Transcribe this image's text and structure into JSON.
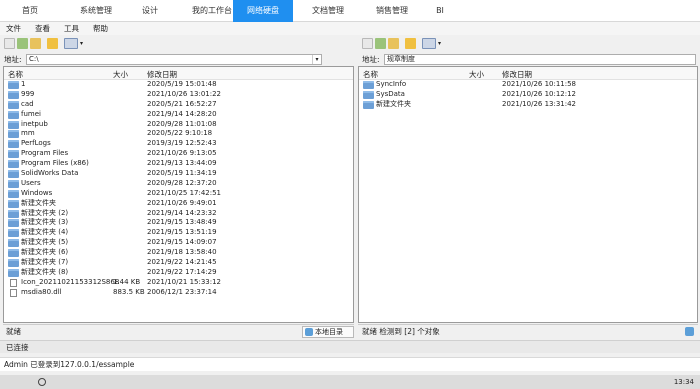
{
  "topnav": {
    "tabs": [
      "首页",
      "系统管理",
      "设计",
      "我的工作台",
      "网络硬盘",
      "文档管理",
      "销售管理",
      "BI"
    ],
    "active_index": 4
  },
  "menubar": [
    "文件",
    "查看",
    "工具",
    "帮助"
  ],
  "left": {
    "address_label": "地址:",
    "address_value": "C:\\",
    "columns": {
      "name": "名称",
      "size": "大小",
      "date": "修改日期"
    },
    "rows": [
      {
        "name": "1",
        "size": "",
        "date": "2020/5/19 15:01:48",
        "type": "folder"
      },
      {
        "name": "999",
        "size": "",
        "date": "2021/10/26 13:01:22",
        "type": "folder"
      },
      {
        "name": "cad",
        "size": "",
        "date": "2020/5/21 16:52:27",
        "type": "folder"
      },
      {
        "name": "fumei",
        "size": "",
        "date": "2021/9/14 14:28:20",
        "type": "folder"
      },
      {
        "name": "inetpub",
        "size": "",
        "date": "2020/9/28 11:01:08",
        "type": "folder"
      },
      {
        "name": "mm",
        "size": "",
        "date": "2020/5/22 9:10:18",
        "type": "folder"
      },
      {
        "name": "PerfLogs",
        "size": "",
        "date": "2019/3/19 12:52:43",
        "type": "folder"
      },
      {
        "name": "Program Files",
        "size": "",
        "date": "2021/10/26 9:13:05",
        "type": "folder"
      },
      {
        "name": "Program Files (x86)",
        "size": "",
        "date": "2021/9/13 13:44:09",
        "type": "folder"
      },
      {
        "name": "SolidWorks Data",
        "size": "",
        "date": "2020/5/19 11:34:19",
        "type": "folder"
      },
      {
        "name": "Users",
        "size": "",
        "date": "2020/9/28 12:37:20",
        "type": "folder"
      },
      {
        "name": "Windows",
        "size": "",
        "date": "2021/10/25 17:42:51",
        "type": "folder"
      },
      {
        "name": "新建文件夹",
        "size": "",
        "date": "2021/10/26 9:49:01",
        "type": "folder"
      },
      {
        "name": "新建文件夹 (2)",
        "size": "",
        "date": "2021/9/14 14:23:32",
        "type": "folder"
      },
      {
        "name": "新建文件夹 (3)",
        "size": "",
        "date": "2021/9/15 13:48:49",
        "type": "folder"
      },
      {
        "name": "新建文件夹 (4)",
        "size": "",
        "date": "2021/9/15 13:51:19",
        "type": "folder"
      },
      {
        "name": "新建文件夹 (5)",
        "size": "",
        "date": "2021/9/15 14:09:07",
        "type": "folder"
      },
      {
        "name": "新建文件夹 (6)",
        "size": "",
        "date": "2021/9/18 13:58:40",
        "type": "folder"
      },
      {
        "name": "新建文件夹 (7)",
        "size": "",
        "date": "2021/9/22 14:21:45",
        "type": "folder"
      },
      {
        "name": "新建文件夹 (8)",
        "size": "",
        "date": "2021/9/22 17:14:29",
        "type": "folder"
      },
      {
        "name": "Icon_20211021153312S868",
        "size": "1.44 KB",
        "date": "2021/10/21 15:33:12",
        "type": "file"
      },
      {
        "name": "msdia80.dll",
        "size": "883.5 KB",
        "date": "2006/12/1 23:37:14",
        "type": "file"
      }
    ],
    "status_text": "就绪",
    "status_button": "本地目录"
  },
  "right": {
    "address_label": "地址:",
    "address_value": "规章制度",
    "columns": {
      "name": "名称",
      "size": "大小",
      "date": "修改日期"
    },
    "rows": [
      {
        "name": "SyncInfo",
        "size": "",
        "date": "2021/10/26 10:11:58",
        "type": "folder"
      },
      {
        "name": "SysData",
        "size": "",
        "date": "2021/10/26 10:12:12",
        "type": "folder"
      },
      {
        "name": "新建文件夹",
        "size": "",
        "date": "2021/10/26 13:31:42",
        "type": "folder"
      }
    ],
    "status_text": "就绪  检测到 [2] 个对象"
  },
  "connection_status": "已连接",
  "login_status": "Admin 已登录到127.0.0.1/essample",
  "taskbar_clock": "13:34"
}
